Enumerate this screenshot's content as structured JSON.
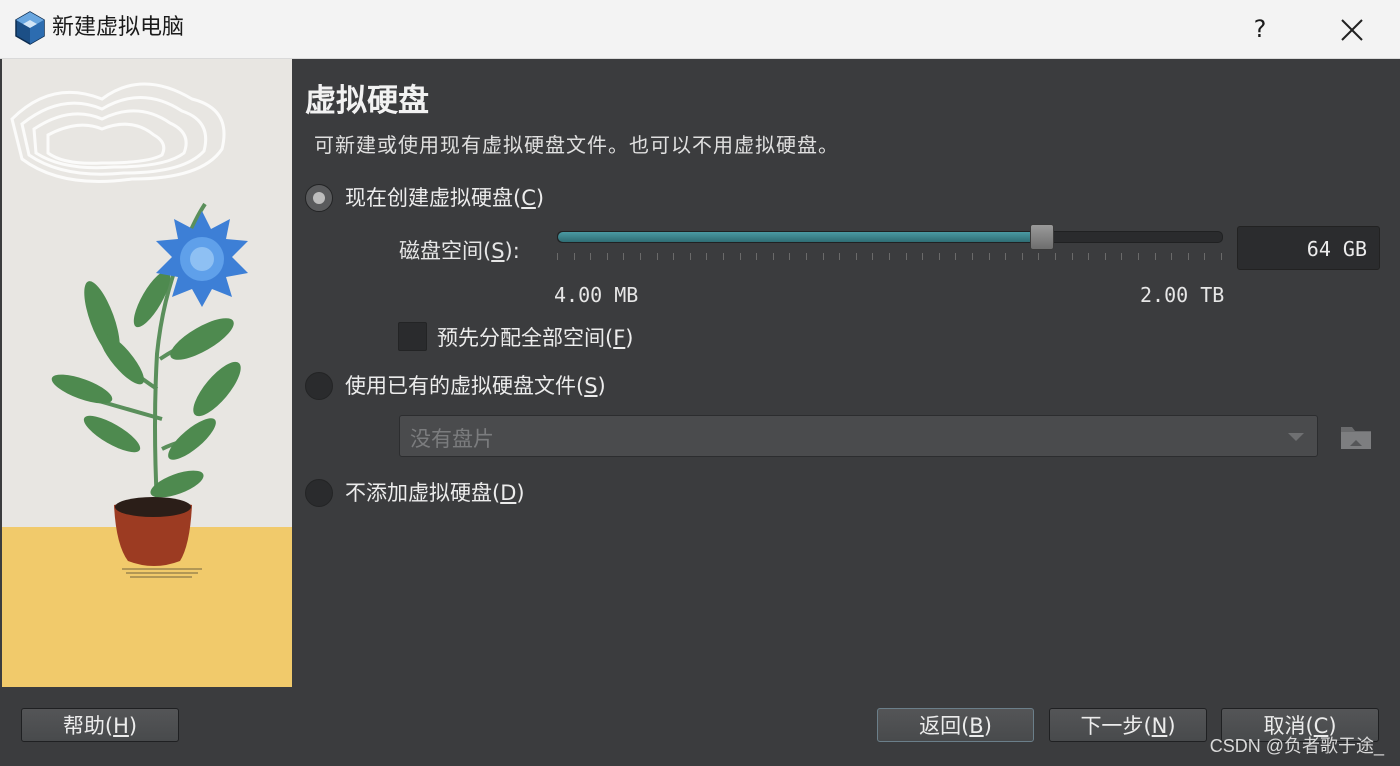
{
  "window": {
    "title": "新建虚拟电脑",
    "help_glyph": "?"
  },
  "page": {
    "title": "虚拟硬盘",
    "description": "可新建或使用现有虚拟硬盘文件。也可以不用虚拟硬盘。"
  },
  "options": {
    "create_now": {
      "text": "现在创建虚拟硬盘",
      "mnemonic": "C",
      "checked": true
    },
    "use_existing": {
      "text": "使用已有的虚拟硬盘文件",
      "mnemonic": "S",
      "checked": false
    },
    "no_disk": {
      "text": "不添加虚拟硬盘",
      "mnemonic": "D",
      "checked": false
    }
  },
  "disk_size": {
    "label": "磁盘空间",
    "mnemonic": "S",
    "value": "64 GB",
    "min_label": "4.00 MB",
    "max_label": "2.00 TB",
    "slider_fraction": 0.727
  },
  "preallocate": {
    "text": "预先分配全部空间",
    "mnemonic": "F",
    "checked": false
  },
  "existing_disk": {
    "selected": "没有盘片"
  },
  "buttons": {
    "help": {
      "text": "帮助",
      "mnemonic": "H"
    },
    "back": {
      "text": "返回",
      "mnemonic": "B"
    },
    "next": {
      "text": "下一步",
      "mnemonic": "N"
    },
    "cancel": {
      "text": "取消",
      "mnemonic": "C"
    }
  },
  "watermark": "CSDN @负者歌于途_",
  "colors": {
    "background": "#3b3c3e",
    "slider_fill": "#3e8791",
    "titlebar": "#f3f3f3",
    "sand": "#f1ca6b"
  },
  "icons": {
    "app": "virtualbox-icon",
    "close": "close-icon",
    "folder": "folder-icon",
    "dropdown": "chevron-down-icon"
  }
}
